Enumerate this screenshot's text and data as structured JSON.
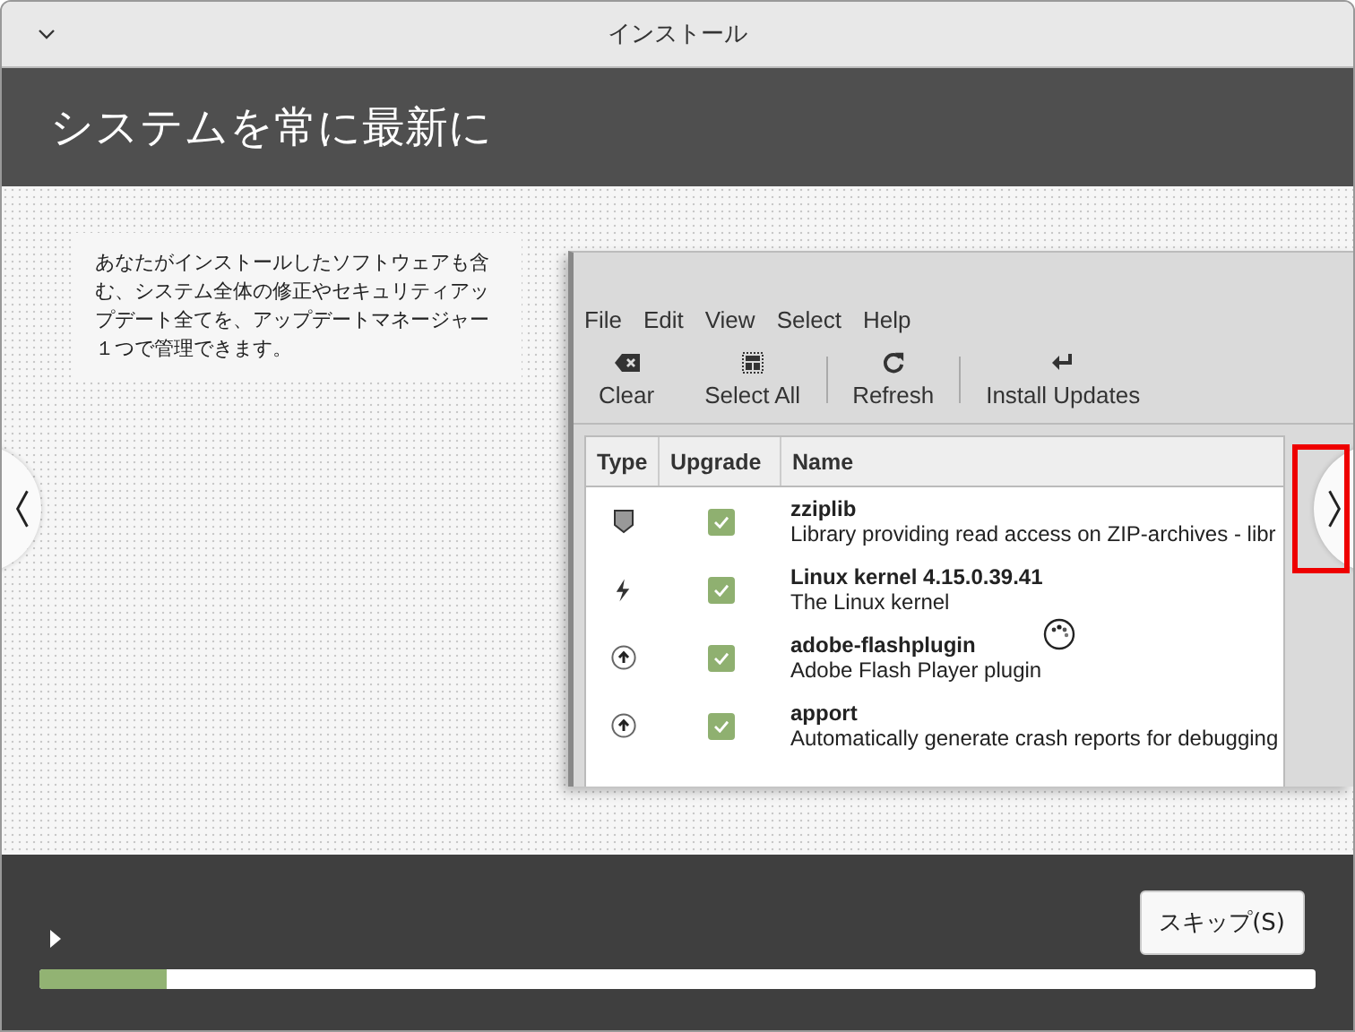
{
  "window": {
    "title": "インストール"
  },
  "header": {
    "title": "システムを常に最新に"
  },
  "description": "あなたがインストールしたソフトウェアも含む、システム全体の修正やセキュリティアップデート全てを、アップデートマネージャー１つで管理できます。",
  "app": {
    "menu": [
      "File",
      "Edit",
      "View",
      "Select",
      "Help"
    ],
    "toolbar": [
      {
        "kind": "clear",
        "label": "Clear"
      },
      {
        "kind": "select-all",
        "label": "Select All"
      },
      {
        "kind": "refresh",
        "label": "Refresh"
      },
      {
        "kind": "install",
        "label": "Install Updates"
      }
    ],
    "columns": [
      "Type",
      "Upgrade",
      "Name"
    ],
    "rows": [
      {
        "kind": "security",
        "checked": true,
        "name": "zziplib",
        "description": "Library providing read access on ZIP-archives - libr"
      },
      {
        "kind": "kernel",
        "checked": true,
        "name": "Linux kernel 4.15.0.39.41",
        "description": "The Linux kernel"
      },
      {
        "kind": "update",
        "checked": true,
        "name": "adobe-flashplugin",
        "description": "Adobe Flash Player plugin"
      },
      {
        "kind": "update",
        "checked": true,
        "name": "apport",
        "description": "Automatically generate crash reports for debugging"
      }
    ]
  },
  "highlight_next": true,
  "footer": {
    "skip_button": "スキップ(S)",
    "progress": {
      "level": 0.1
    }
  }
}
